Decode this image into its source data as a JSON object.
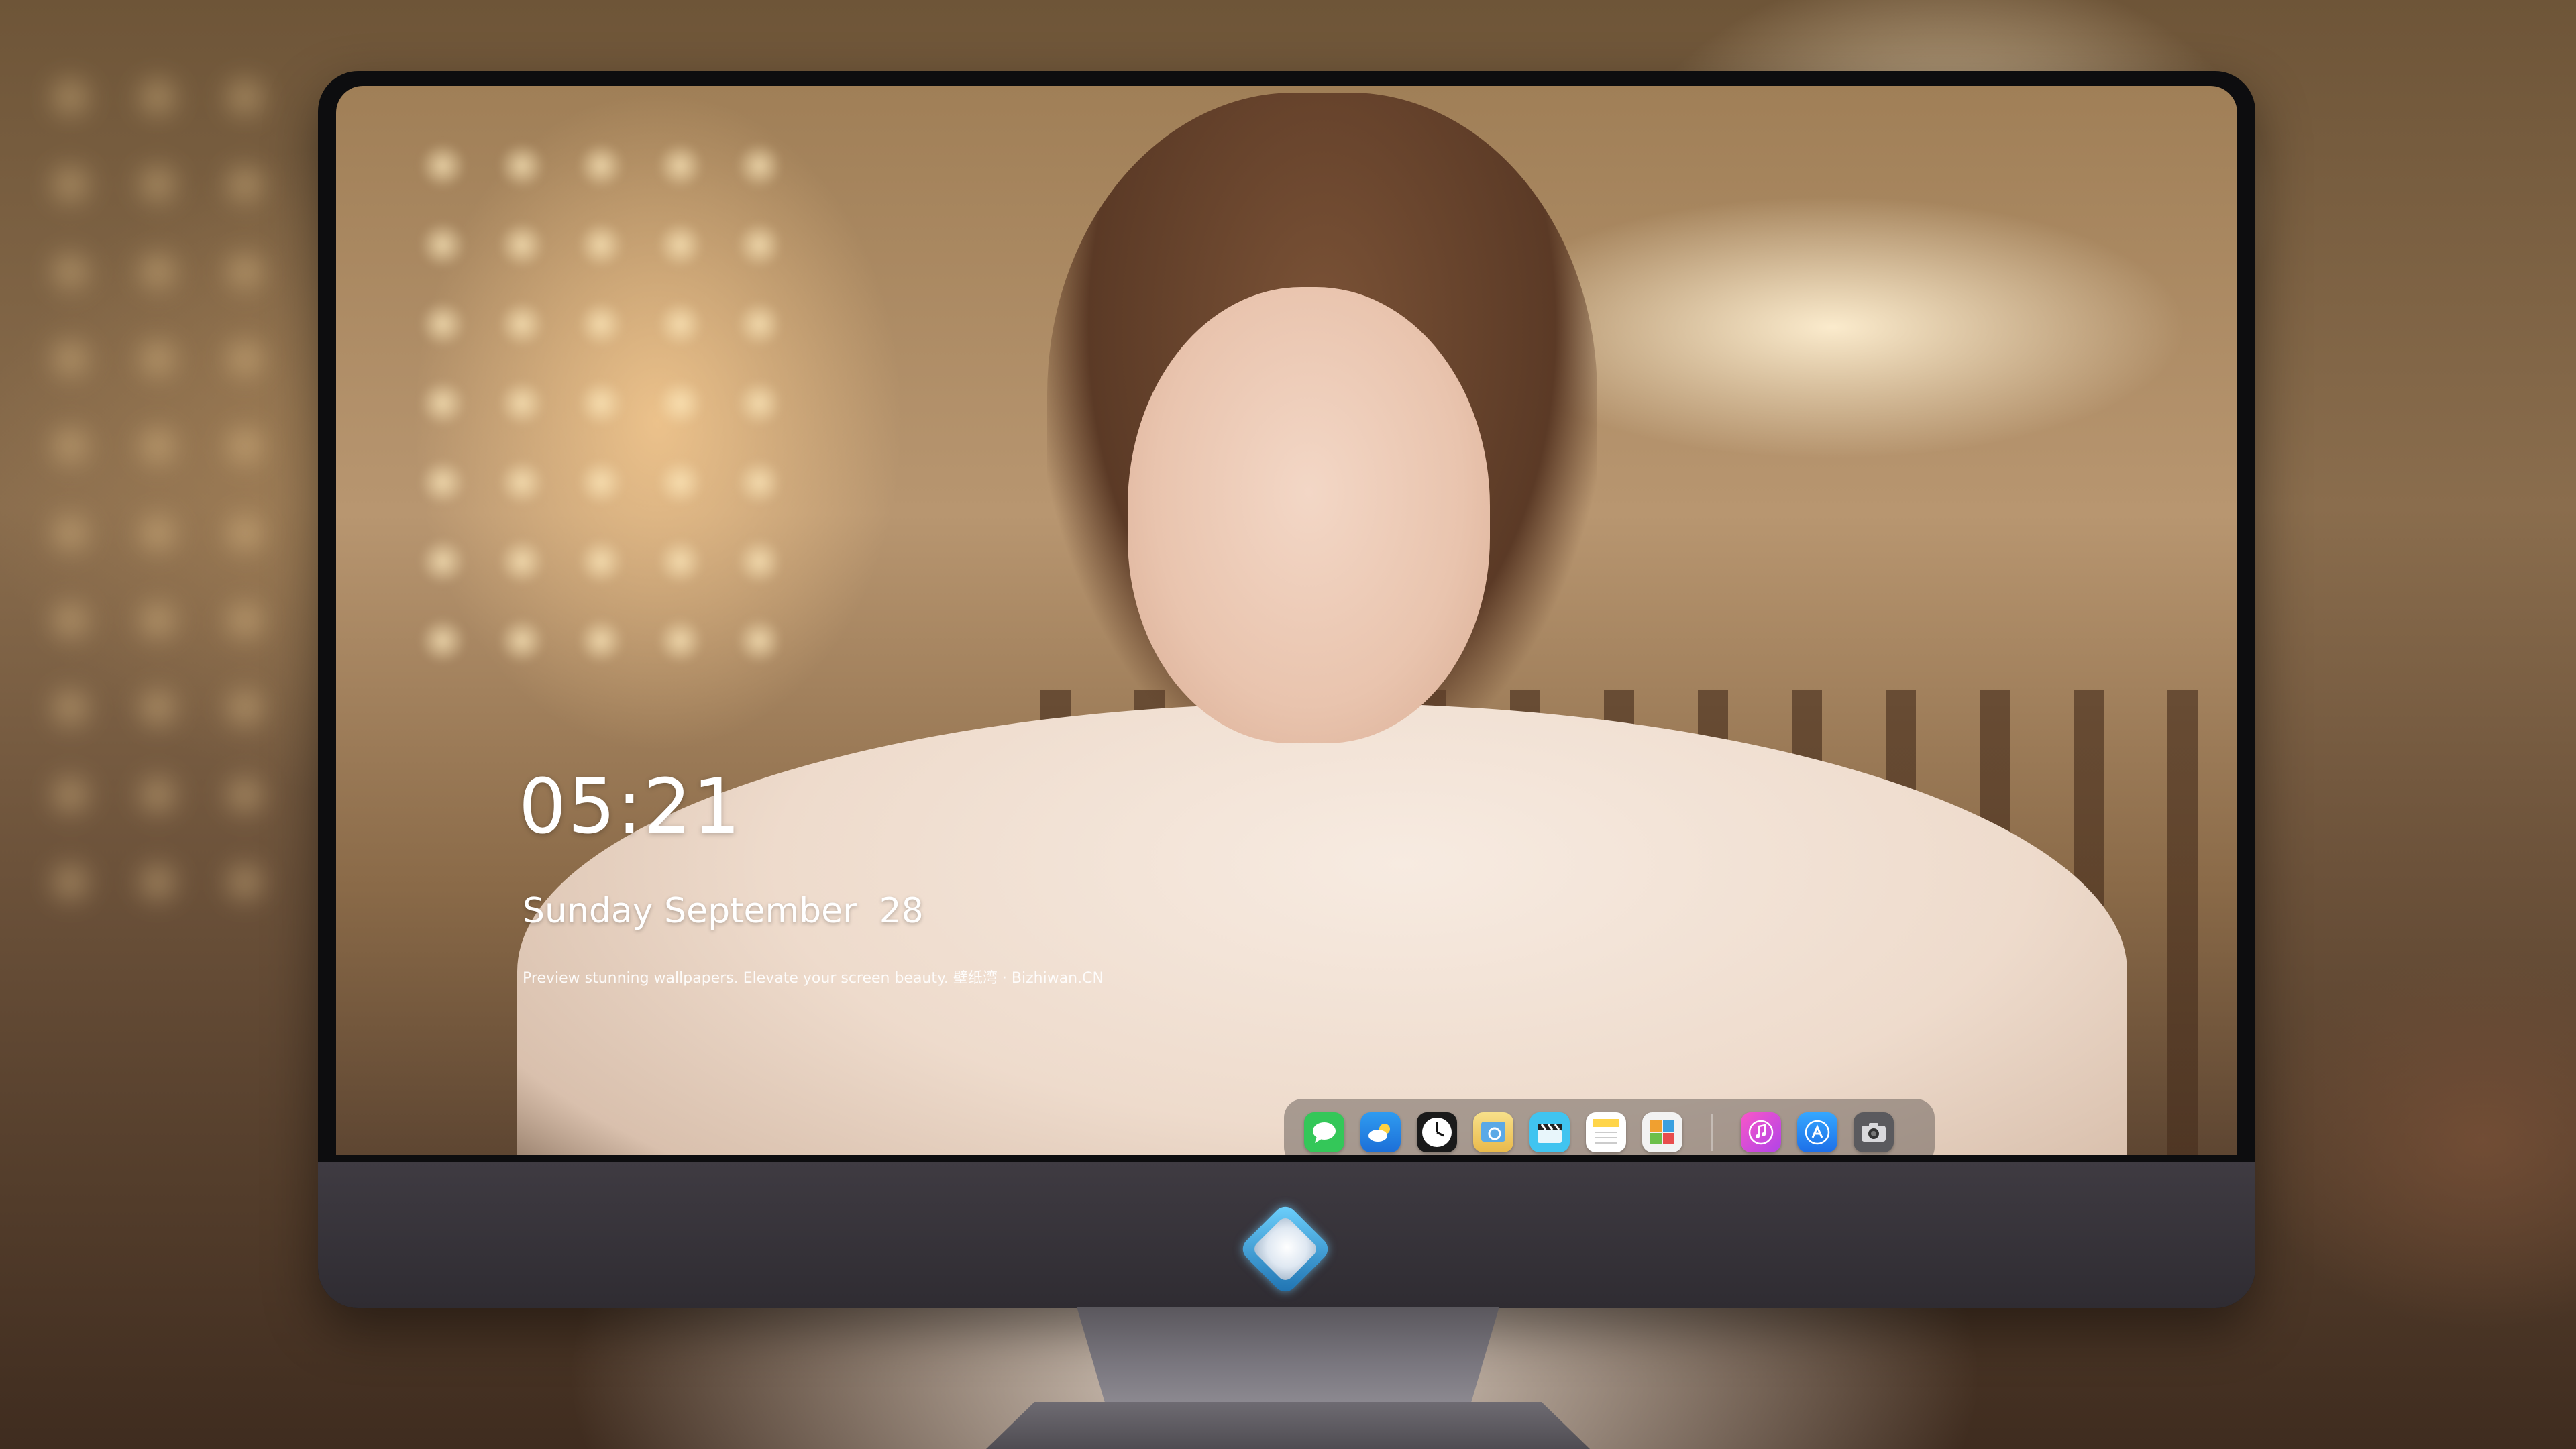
{
  "lock_screen": {
    "time": "05:21",
    "date": "Sunday September  28",
    "caption": "Preview stunning wallpapers. Elevate your screen beauty. 壁纸湾 · Bizhiwan.CN"
  },
  "dock": {
    "apps": [
      {
        "name": "messages",
        "icon": "chat-bubble",
        "color": "#34c759"
      },
      {
        "name": "weather",
        "icon": "cloud-sun",
        "color": "#2f9bf0"
      },
      {
        "name": "clock",
        "icon": "clock",
        "color": "#1a1a1a"
      },
      {
        "name": "preview",
        "icon": "image-viewer",
        "color": "#f2d45c"
      },
      {
        "name": "clips",
        "icon": "clapperboard",
        "color": "#40c4f0"
      },
      {
        "name": "notes",
        "icon": "notes",
        "color": "#ffd54a"
      },
      {
        "name": "photo-booth",
        "icon": "photo-grid",
        "color": "#7cc36a"
      },
      {
        "name": "music",
        "icon": "music-note",
        "color": "#e84fd9"
      },
      {
        "name": "app-store",
        "icon": "app-store-a",
        "color": "#1e88f5"
      },
      {
        "name": "camera",
        "icon": "camera",
        "color": "#5a5a5e"
      }
    ]
  },
  "chin": {
    "logo": "dragon-badge-icon"
  }
}
